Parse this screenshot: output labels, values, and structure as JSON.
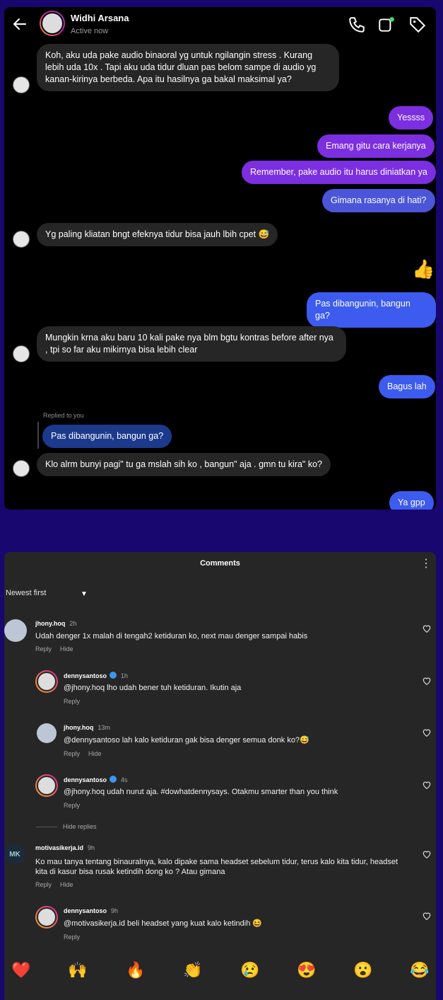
{
  "dm": {
    "name": "Widhi Arsana",
    "status": "Active now",
    "messages": [
      {
        "text": "Koh, aku uda pake audio binaoral yg untuk ngilangin stress . Kurang lebih uda 10x . Tapi aku uda tidur dluan pas belom sampe di audio yg kanan-kirinya berbeda. Apa itu hasilnya ga bakal maksimal ya?"
      },
      {
        "text": "Yessss"
      },
      {
        "text": "Emang gitu cara kerjanya"
      },
      {
        "text": "Remember, pake audio itu harus diniatkan ya"
      },
      {
        "text": "Gimana rasanya di hati?"
      },
      {
        "text": "Yg paling kliatan bngt efeknya tidur bisa jauh lbih cpet 😅"
      },
      {
        "text": "Pas dibangunin, bangun ga?"
      },
      {
        "text": "Mungkin krna aku baru 10 kali pake nya blm bgtu kontras before after nya , tpi so far aku mikirnya bisa lebih clear"
      },
      {
        "text": "Bagus lah"
      },
      {
        "text": "Pas dibangunin, bangun ga?"
      },
      {
        "text": "Klo alrm bunyi pagi\" tu ga mslah sih ko , bangun\" aja . gmn tu kira\" ko?"
      },
      {
        "text": "Ya gpp"
      }
    ],
    "replied_label": "Replied to you",
    "thumb": "👍"
  },
  "comments": {
    "title": "Comments",
    "sort": "Newest first",
    "hide_replies": "Hide replies",
    "items": [
      {
        "user": "jhony.hoq",
        "time": "2h",
        "text": "Udah denger 1x malah di tengah2 ketiduran ko, next mau denger sampai habis",
        "reply": "Reply",
        "hide": "Hide"
      },
      {
        "user": "dennysantoso",
        "time": "1h",
        "text": "@jhony.hoq lho udah bener tuh ketiduran. Ikutin aja",
        "reply": "Reply",
        "hide": ""
      },
      {
        "user": "jhony.hoq",
        "time": "13m",
        "text": "@dennysantoso lah kalo ketiduran gak bisa denger semua donk ko?😅",
        "reply": "Reply",
        "hide": "Hide"
      },
      {
        "user": "dennysantoso",
        "time": "4s",
        "text": "@jhony.hoq udah nurut aja. #dowhatdennysays. Otakmu smarter than you think",
        "reply": "Reply",
        "hide": ""
      },
      {
        "user": "motivasikerja.id",
        "time": "9h",
        "text": "Ko mau tanya tentang binauralnya, kalo dipake sama headset sebelum tidur, terus kalo kita tidur, headset kita di kasur bisa rusak ketindih dong ko ? Atau gimana",
        "reply": "Reply",
        "hide": "Hide"
      },
      {
        "user": "dennysantoso",
        "time": "9h",
        "text": "@motivasikerja.id beli headset yang kuat kalo ketindih 😆",
        "reply": "Reply",
        "hide": ""
      }
    ],
    "avatar_mk": "MK",
    "emojis": [
      "❤️",
      "🙌",
      "🔥",
      "👏",
      "😢",
      "😍",
      "😮",
      "😂"
    ]
  }
}
